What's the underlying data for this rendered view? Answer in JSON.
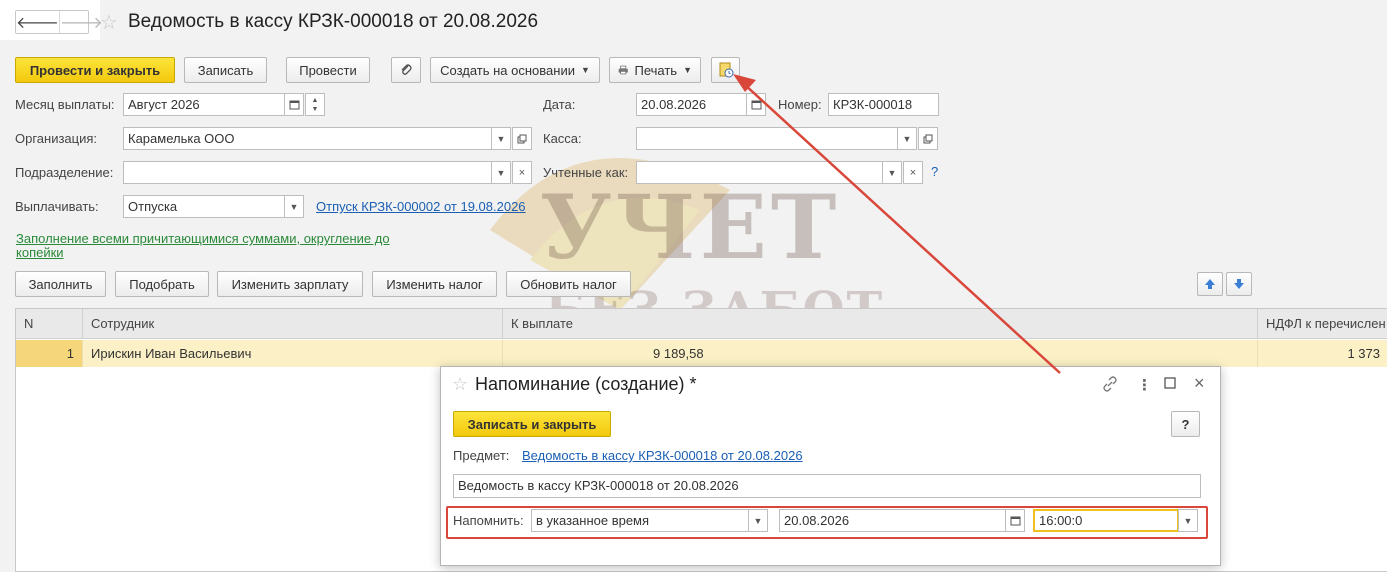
{
  "header": {
    "back_label": "🡐",
    "forward_label": "🡒",
    "favorite_icon": "☆",
    "title": "Ведомость в кассу КРЗК-000018 от 20.08.2026"
  },
  "toolbar": {
    "post_close": "Провести и закрыть",
    "save": "Записать",
    "post": "Провести",
    "create_based": "Создать на основании",
    "print": "Печать",
    "attach_icon": "paperclip-icon",
    "reminder_icon": "reminder-icon"
  },
  "form": {
    "month_label": "Месяц выплаты:",
    "month_value": "Август 2026",
    "date_label": "Дата:",
    "date_value": "20.08.2026",
    "number_label": "Номер:",
    "number_value": "КРЗК-000018",
    "org_label": "Организация:",
    "org_value": "Карамелька ООО",
    "cash_label": "Касса:",
    "cash_value": "",
    "dept_label": "Подразделение:",
    "dept_value": "",
    "counted_label": "Учтенные как:",
    "counted_value": "",
    "help": "?",
    "pay_label": "Выплачивать:",
    "pay_value": "Отпуска",
    "vacation_link": "Отпуск КРЗК-000002 от 19.08.2026",
    "fill_link_line1": "Заполнение всеми причитающимися суммами, округление до",
    "fill_link_line2": "копейки"
  },
  "table_toolbar": {
    "fill": "Заполнить",
    "pick": "Подобрать",
    "change_salary": "Изменить зарплату",
    "change_tax": "Изменить налог",
    "refresh_tax": "Обновить налог"
  },
  "table": {
    "columns": [
      "N",
      "Сотрудник",
      "К выплате",
      "НДФЛ к перечислен"
    ],
    "rows": [
      {
        "n": "1",
        "employee": "Ирискин Иван Васильевич",
        "amount": "9 189,58",
        "ndfl": "1 373"
      }
    ]
  },
  "watermark": {
    "line1": "УЧЕТ",
    "line2": "БЕЗ ЗАБОТ"
  },
  "dialog": {
    "title": "Напоминание (создание) *",
    "save_close": "Записать и закрыть",
    "help": "?",
    "subject_label": "Предмет:",
    "subject_link": "Ведомость в кассу КРЗК-000018 от 20.08.2026",
    "description_value": "Ведомость в кассу КРЗК-000018 от 20.08.2026",
    "remind_label": "Напомнить:",
    "remind_mode": "в указанное время",
    "remind_date": "20.08.2026",
    "remind_time": "16:00:0"
  },
  "colors": {
    "primary_button": "#f5d11c",
    "selected_row": "#fbf0c6",
    "link": "#1a5fb4",
    "green_link": "#2a8a3a",
    "annotation_red": "#d9473a"
  }
}
